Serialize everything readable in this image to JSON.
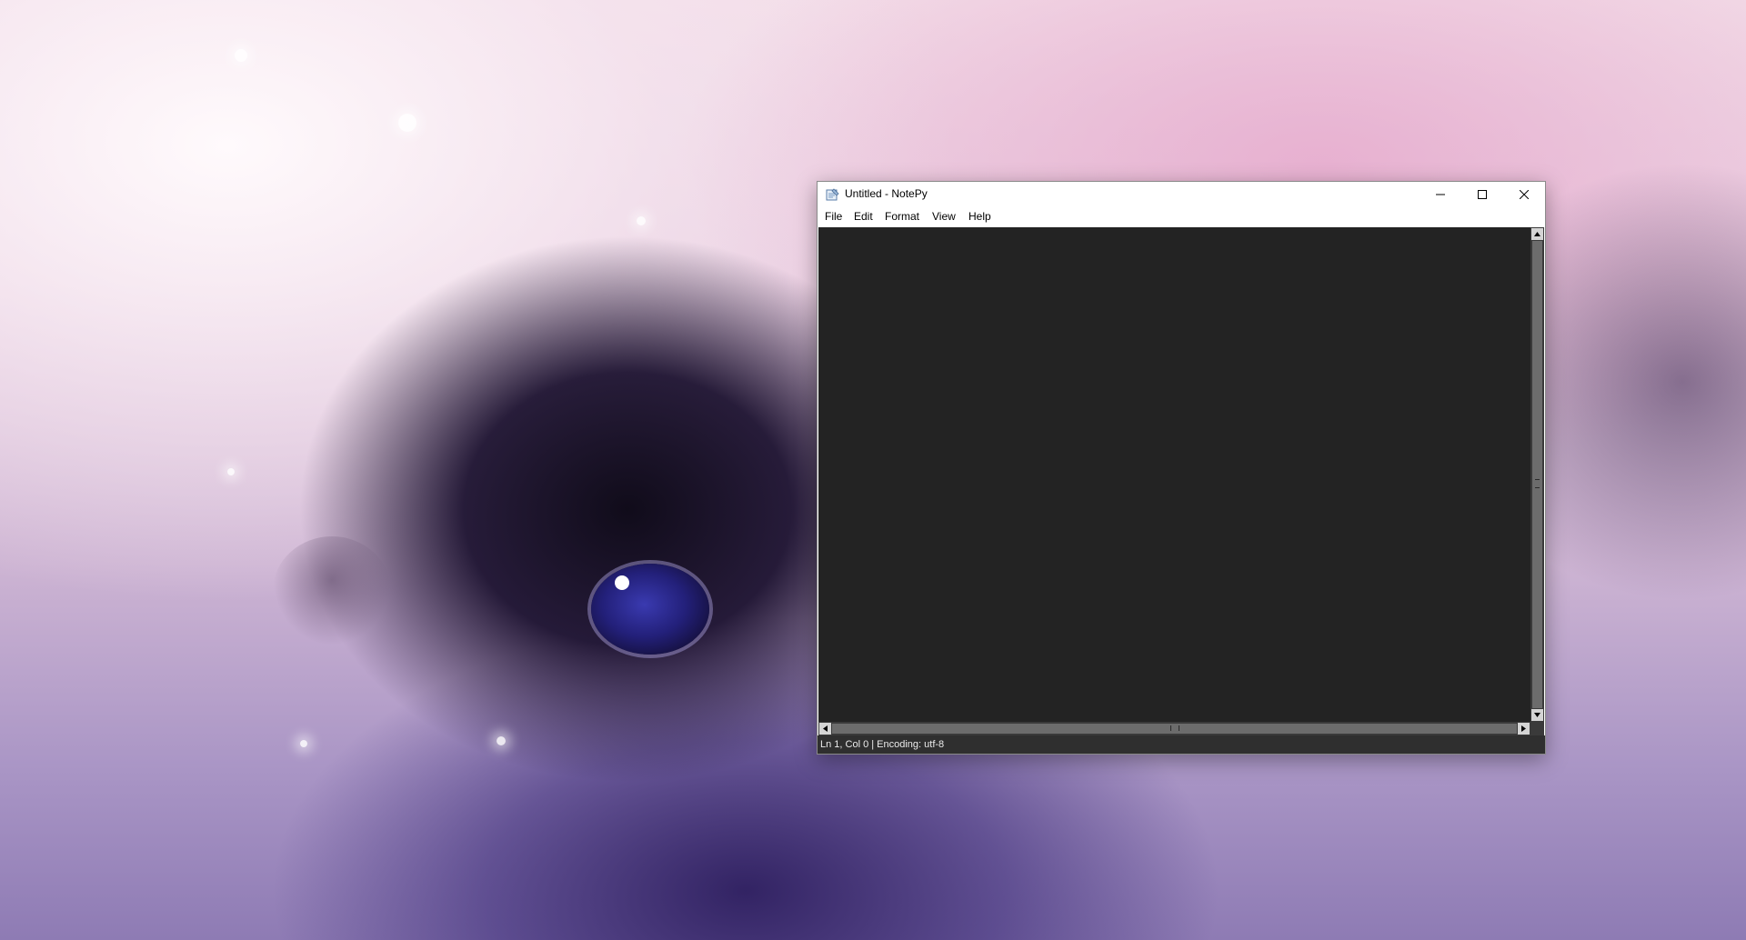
{
  "window": {
    "title": "Untitled - NotePy",
    "app_icon": "notepad-icon",
    "controls": {
      "minimize": "minimize-icon",
      "maximize": "maximize-icon",
      "close": "close-icon"
    }
  },
  "menu": {
    "file": "File",
    "edit": "Edit",
    "format": "Format",
    "view": "View",
    "help": "Help"
  },
  "editor": {
    "content": "",
    "background": "#232323"
  },
  "status": {
    "text": "Ln 1, Col 0 | Encoding: utf-8"
  },
  "desktop": {
    "wallpaper": "black kitten on pastel pink background"
  }
}
